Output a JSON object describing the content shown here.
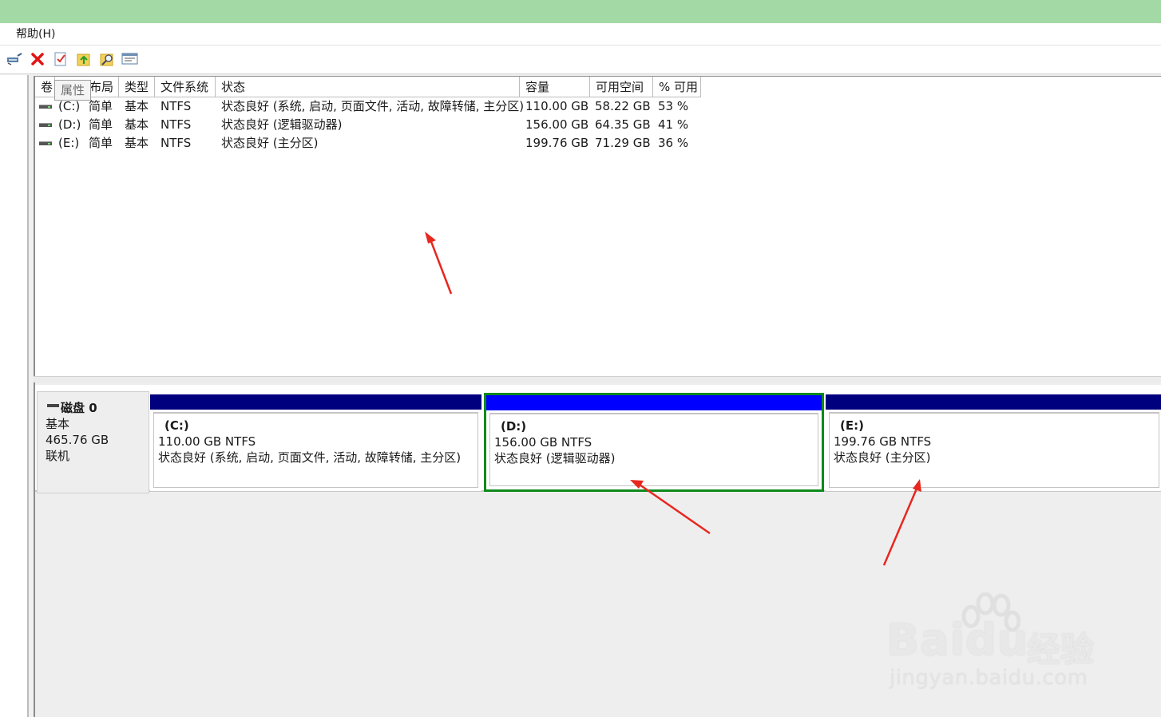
{
  "menu": {
    "help": "帮助(H)"
  },
  "toolbar": {
    "buttons": [
      {
        "icon": "connect-icon"
      },
      {
        "icon": "delete-icon"
      },
      {
        "icon": "checklist-icon"
      },
      {
        "icon": "up-folder-icon"
      },
      {
        "icon": "search-folder-icon"
      },
      {
        "icon": "properties-icon"
      }
    ]
  },
  "tooltip": {
    "text": "属性"
  },
  "volume_list": {
    "columns": [
      "卷",
      "布局",
      "类型",
      "文件系统",
      "状态",
      "容量",
      "可用空间",
      "% 可用"
    ],
    "rows": [
      {
        "volume": "(C:)",
        "layout": "简单",
        "type": "基本",
        "fs": "NTFS",
        "status": "状态良好 (系统, 启动, 页面文件, 活动, 故障转储, 主分区)",
        "capacity": "110.00 GB",
        "free": "58.22 GB",
        "pct": "53 %"
      },
      {
        "volume": "(D:)",
        "layout": "简单",
        "type": "基本",
        "fs": "NTFS",
        "status": "状态良好 (逻辑驱动器)",
        "capacity": "156.00 GB",
        "free": "64.35 GB",
        "pct": "41 %"
      },
      {
        "volume": "(E:)",
        "layout": "简单",
        "type": "基本",
        "fs": "NTFS",
        "status": "状态良好 (主分区)",
        "capacity": "199.76 GB",
        "free": "71.29 GB",
        "pct": "36 %"
      }
    ]
  },
  "disk": {
    "name": "磁盘 0",
    "type": "基本",
    "size": "465.76 GB",
    "state": "联机",
    "partitions": [
      {
        "name": "(C:)",
        "size_fs": "110.00 GB NTFS",
        "status": "状态良好 (系统, 启动, 页面文件, 活动, 故障转储, 主分区)",
        "selected": false
      },
      {
        "name": "(D:)",
        "size_fs": "156.00 GB NTFS",
        "status": "状态良好 (逻辑驱动器)",
        "selected": true
      },
      {
        "name": "(E:)",
        "size_fs": "199.76 GB NTFS",
        "status": "状态良好 (主分区)",
        "selected": false
      }
    ]
  },
  "colors": {
    "titlebar": "#a3d9a5",
    "primary_bar": "#00007f",
    "selected_bar": "#0000ff",
    "selected_border": "#0d8a1c",
    "annotation_arrow": "#e8271f"
  },
  "watermark": {
    "brand": "Bai",
    "brand_tail": "du",
    "brand_cn": "经验",
    "url": "jingyan.baidu.com"
  }
}
